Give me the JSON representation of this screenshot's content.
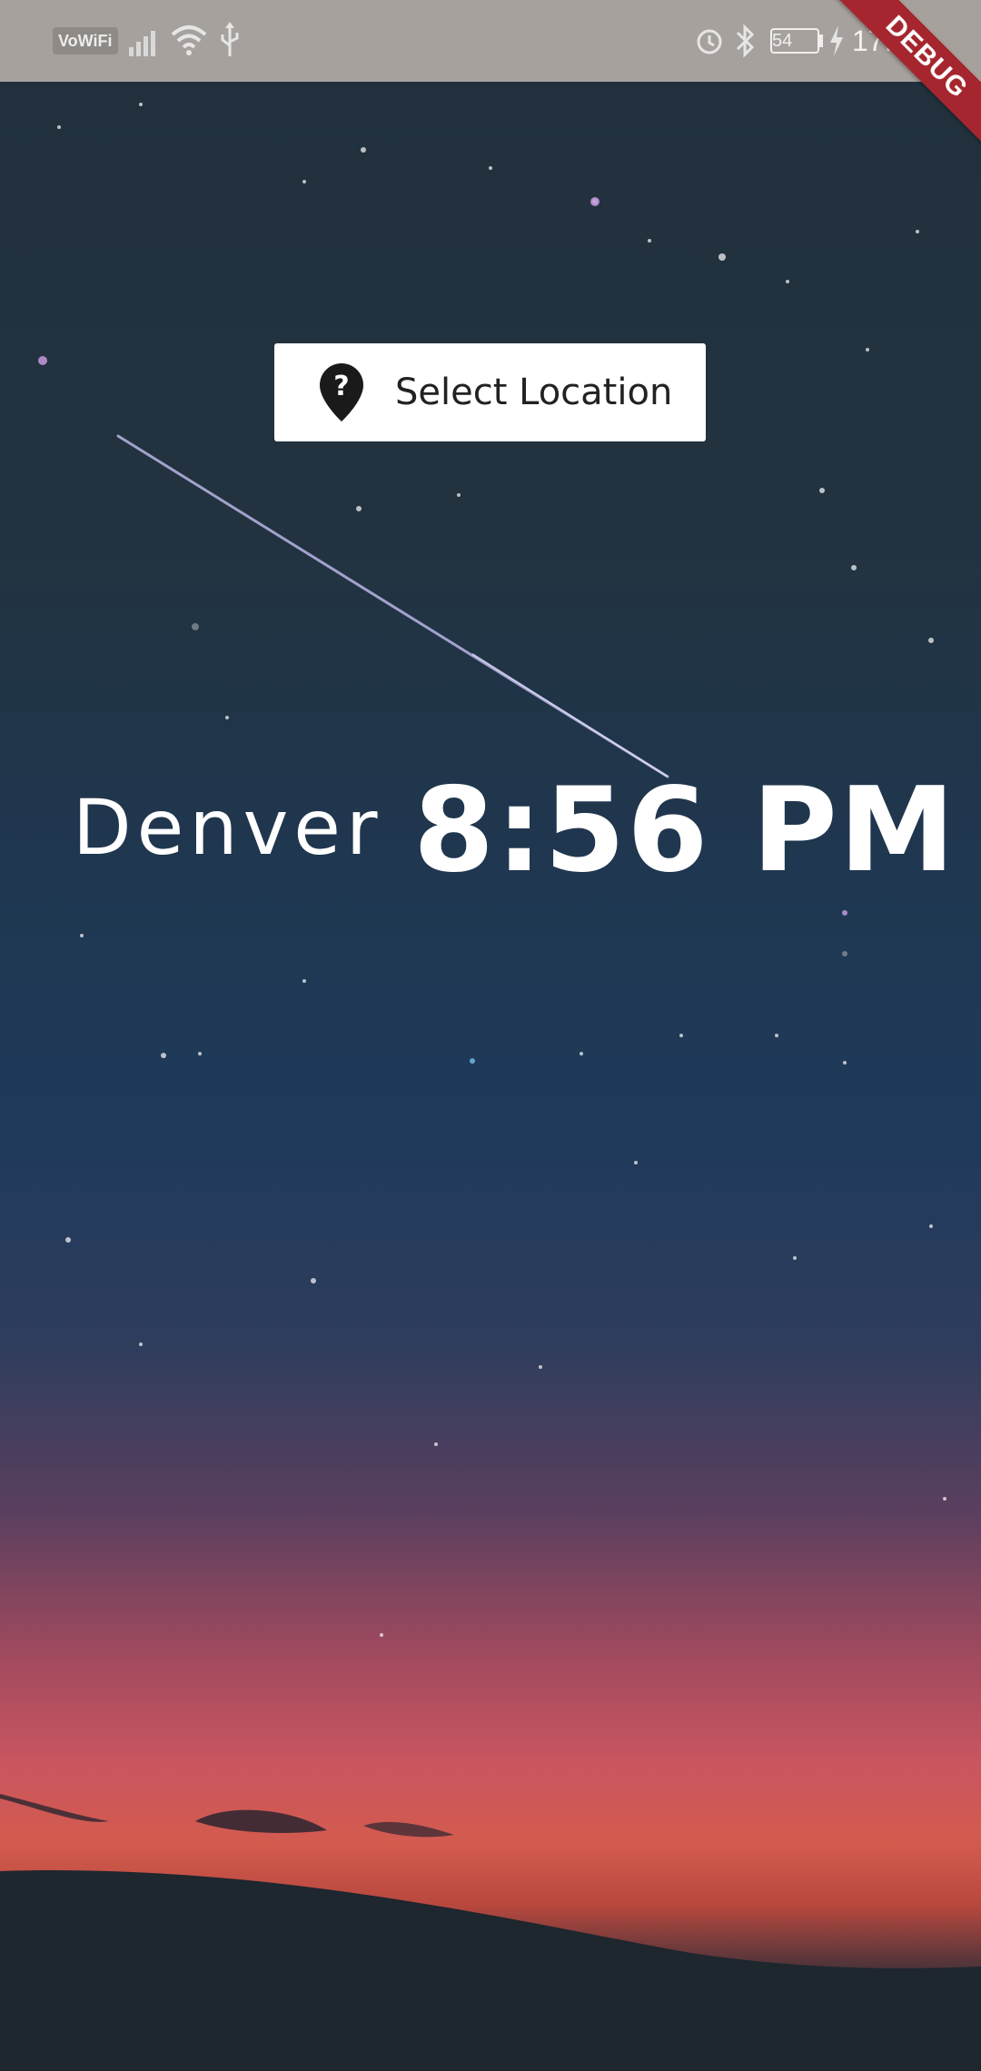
{
  "status_bar": {
    "vowifi_label": "VoWiFi",
    "battery_level": "54",
    "time": "17:56",
    "icons": [
      "signal-icon",
      "wifi-icon",
      "usb-icon",
      "alarm-icon",
      "bluetooth-icon",
      "battery-icon",
      "charging-icon"
    ]
  },
  "debug_banner": "DEBUG",
  "location_button": {
    "label": "Select Location",
    "icon": "location-help-icon"
  },
  "main": {
    "city": "Denver",
    "time": "8:56 PM"
  },
  "colors": {
    "status_bar_bg": "#a7a19d",
    "debug_banner": "#a5262e",
    "button_bg": "#ffffff",
    "text": "#ffffff"
  }
}
